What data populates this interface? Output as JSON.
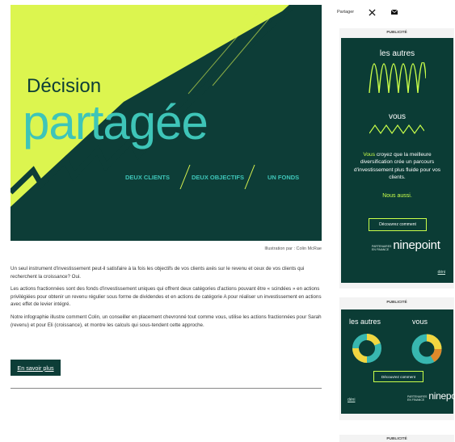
{
  "hero": {
    "title_line1": "Décision",
    "title_line2": "partagée",
    "tagline1": "DEUX CLIENTS",
    "tagline2": "DEUX OBJECTIFS",
    "tagline3": "UN FONDS",
    "credit": "Illustration par : Colin McRae",
    "colors": {
      "lime": "#dcf54f",
      "dark": "#0d3d37",
      "teal": "#3ec5b8"
    }
  },
  "article": {
    "paragraphs": [
      "Un seul instrument d'investissement peut-il satisfaire à la fois les objectifs de vos clients axés sur le revenu et ceux de vos clients qui recherchent la croissance? Oui.",
      "Les actions fractionnées sont des fonds d'investissement uniques qui offrent deux catégories d'actions pouvant être « scindées » en actions privilégiées pour obtenir un revenu régulier sous forme de dividendes et en actions de catégorie A pour réaliser un investissement en actions avec effet de levier intégré.",
      "Notre infographie illustre comment Colin, un conseiller en placement chevronné tout comme vous, utilise les actions fractionnées pour Sarah (revenu) et pour Eli (croissance), et montre les calculs qui sous-tendent cette approche."
    ],
    "learn_more": "En savoir plus"
  },
  "share": {
    "label": "Partager",
    "icons": [
      "x-icon",
      "email-icon"
    ]
  },
  "ads": {
    "label": "PUBLICITÉ",
    "ad1": {
      "heading_top": "les autres",
      "heading_mid": "vous",
      "body_highlight": "Vous",
      "body": " croyez que la meilleure diversification crée un parcours d'investissement plus fluide pour vos clients.",
      "tagline": "Nous aussi.",
      "cta": "Découvrez comment",
      "brand_small1": "PARTENAIRES",
      "brand_small2": "EN FINANCE",
      "brand": "ninepoint",
      "deni": "déni"
    },
    "ad2": {
      "label_left": "les autres",
      "label_right": "vous",
      "cta": "Découvrez comment",
      "deni": "déni",
      "brand_small1": "PARTENAIRES",
      "brand_small2": "EN FINANCE",
      "brand": "ninepoint"
    },
    "colors": {
      "lime": "#c9ff4a",
      "dark": "#0b3c35",
      "yellow": "#f2d640",
      "cyan": "#38b7b0"
    }
  }
}
